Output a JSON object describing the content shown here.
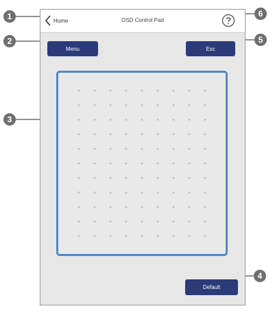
{
  "header": {
    "back_label": "Home",
    "title": "OSD Control Pad",
    "help_icon": "question-mark-circle-icon",
    "back_icon": "chevron-left-icon"
  },
  "buttons": {
    "menu_label": "Menu",
    "esc_label": "Esc",
    "default_label": "Default"
  },
  "touchpad": {
    "rows": 11,
    "cols": 9
  },
  "callouts": [
    "1",
    "2",
    "3",
    "4",
    "5",
    "6"
  ],
  "colors": {
    "button": "#2b3a78",
    "touchpad_border": "#4f88c6",
    "callout": "#6f6f6f"
  }
}
